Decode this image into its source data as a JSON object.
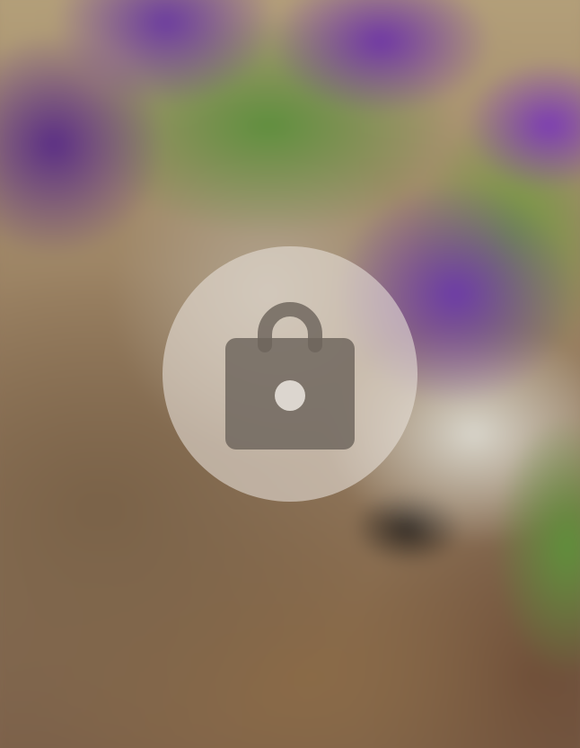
{
  "screen": {
    "background": "blurred-photo",
    "overlay_color": "#e8e2da"
  },
  "lock_button": {
    "icon": "lock-icon",
    "state": "locked"
  }
}
